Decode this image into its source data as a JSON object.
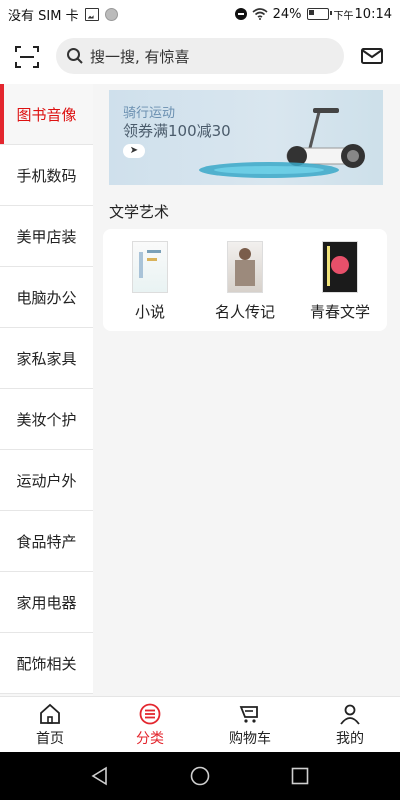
{
  "status_bar": {
    "carrier": "没有 SIM 卡",
    "battery_percent": "24%",
    "time_prefix": "下午",
    "time": "10:14"
  },
  "search": {
    "placeholder": "搜一搜, 有惊喜"
  },
  "sidebar": {
    "items": [
      {
        "label": "图书音像",
        "active": true
      },
      {
        "label": "手机数码",
        "active": false
      },
      {
        "label": "美甲店装",
        "active": false
      },
      {
        "label": "电脑办公",
        "active": false
      },
      {
        "label": "家私家具",
        "active": false
      },
      {
        "label": "美妆个护",
        "active": false
      },
      {
        "label": "运动户外",
        "active": false
      },
      {
        "label": "食品特产",
        "active": false
      },
      {
        "label": "家用电器",
        "active": false
      },
      {
        "label": "配饰相关",
        "active": false
      }
    ]
  },
  "banner": {
    "line1": "骑行运动",
    "line2": "领券满100减30"
  },
  "section": {
    "title": "文学艺术",
    "categories": [
      {
        "label": "小说"
      },
      {
        "label": "名人传记"
      },
      {
        "label": "青春文学"
      }
    ]
  },
  "bottom_nav": {
    "items": [
      {
        "label": "首页",
        "icon": "home-icon",
        "active": false
      },
      {
        "label": "分类",
        "icon": "category-icon",
        "active": true
      },
      {
        "label": "购物车",
        "icon": "cart-icon",
        "active": false
      },
      {
        "label": "我的",
        "icon": "user-icon",
        "active": false
      }
    ]
  },
  "colors": {
    "accent": "#e3262e",
    "background": "#f5f5f5"
  }
}
